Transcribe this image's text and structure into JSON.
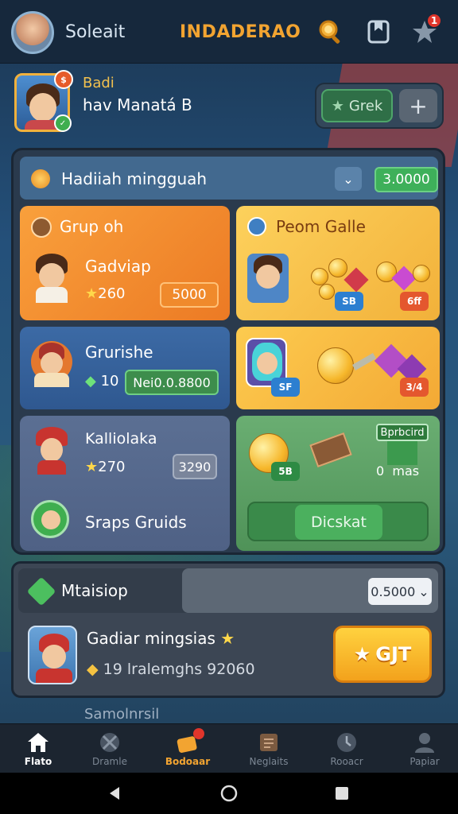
{
  "topbar": {
    "name": "Soleait",
    "title": "INDADERAO",
    "notification_count": "1"
  },
  "profile": {
    "line1": "Badi",
    "line2": "hav Manatá B",
    "greek_label": "Grek",
    "plus_label": "+"
  },
  "weekly": {
    "title": "Hadiiah mingguah",
    "value": "3.0000",
    "cards": {
      "orange": {
        "header": "Grup oh",
        "name": "Gadviap",
        "stars": "260",
        "value": "5000"
      },
      "yellow1": {
        "header": "Peom Galle",
        "tag1": "SB",
        "tag2": "6ff"
      },
      "blue": {
        "name": "Grurishe",
        "count": "10",
        "value": "Nei0.0.8800"
      },
      "yellow2": {
        "tag1": "SF",
        "tag2": "3/4"
      },
      "slate": {
        "name": "Kalliolaka",
        "stars": "270",
        "value": "3290",
        "footer": "Sraps Gruids"
      },
      "green": {
        "badge": "Bprbcird",
        "tag1": "5B",
        "count": "0",
        "tag2": "mas",
        "button": "Dicskat"
      }
    }
  },
  "shop": {
    "title": "Mtaisiop",
    "dropdown": "0.5000",
    "line1": "Gadiar mingsias",
    "line2": "19 lralemghs 92060",
    "button": "GJT"
  },
  "peek": {
    "text": "Samolnrsil"
  },
  "nav": [
    {
      "label": "Flato"
    },
    {
      "label": "Dramle"
    },
    {
      "label": "Bodoaar"
    },
    {
      "label": "Neglaits"
    },
    {
      "label": "Rooacr"
    },
    {
      "label": "Papiar"
    }
  ],
  "colors": {
    "accent": "#f2a431",
    "green": "#3eb05a",
    "blue": "#42698f"
  }
}
